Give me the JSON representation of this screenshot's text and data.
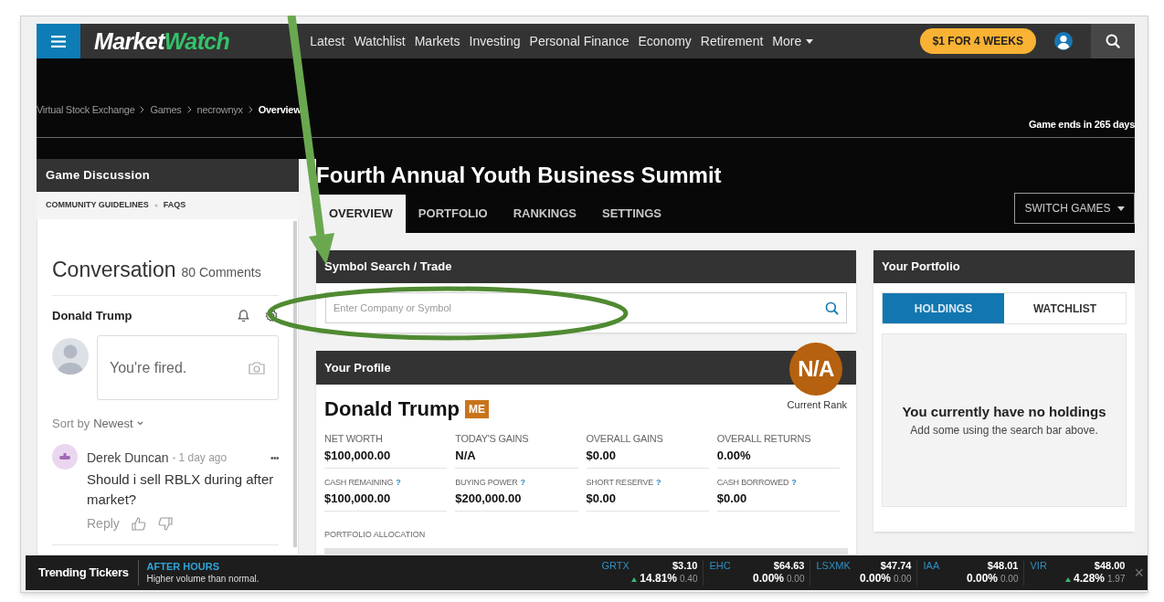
{
  "nav": {
    "logo": {
      "part_1": "Market",
      "part_2": "Watch"
    },
    "links": [
      "Latest",
      "Watchlist",
      "Markets",
      "Investing",
      "Personal Finance",
      "Economy",
      "Retirement",
      "More"
    ],
    "subscribe": "$1 FOR 4 WEEKS"
  },
  "breadcrumb": [
    {
      "label": "Virtual Stock Exchange",
      "current": false
    },
    {
      "label": "Games",
      "current": false
    },
    {
      "label": "necrownyx",
      "current": false
    },
    {
      "label": "Overview",
      "current": true
    }
  ],
  "game_ends": "Game ends in 265 days",
  "game_title": "Fourth Annual Youth Business Summit",
  "tabs": [
    {
      "label": "OVERVIEW",
      "selected": true
    },
    {
      "label": "PORTFOLIO",
      "selected": false
    },
    {
      "label": "RANKINGS",
      "selected": false
    },
    {
      "label": "SETTINGS",
      "selected": false
    }
  ],
  "switch_games": "SWITCH GAMES",
  "discussion": {
    "title": "Game Discussion",
    "links": [
      "COMMUNITY GUIDELINES",
      "FAQS"
    ],
    "heading": "Conversation",
    "count": "80 Comments",
    "user": "Donald Trump",
    "draft": "You're fired.",
    "sort_label": "Sort by",
    "sort_value": "Newest",
    "comments": [
      {
        "author": "Derek Duncan",
        "time": "1 day ago",
        "more": "•••",
        "text": "Should i sell RBLX during after market?",
        "reply": "Reply"
      }
    ]
  },
  "symbol_search": {
    "title": "Symbol Search / Trade",
    "placeholder": "Enter Company or Symbol"
  },
  "profile": {
    "title": "Your Profile",
    "rank": "N/A",
    "rank_label": "Current Rank",
    "name": "Donald Trump",
    "badge": "ME",
    "stats": [
      {
        "label": "NET WORTH",
        "value": "$100,000.00"
      },
      {
        "label": "TODAY'S GAINS",
        "value": "N/A"
      },
      {
        "label": "OVERALL GAINS",
        "value": "$0.00"
      },
      {
        "label": "OVERALL RETURNS",
        "value": "0.00%"
      },
      {
        "label": "CASH REMAINING",
        "help": "?",
        "value": "$100,000.00"
      },
      {
        "label": "BUYING POWER",
        "help": "?",
        "value": "$200,000.00"
      },
      {
        "label": "SHORT RESERVE",
        "help": "?",
        "value": "$0.00"
      },
      {
        "label": "CASH BORROWED",
        "help": "?",
        "value": "$0.00"
      }
    ],
    "allocation_label": "PORTFOLIO ALLOCATION"
  },
  "portfolio": {
    "title": "Your Portfolio",
    "tabs": [
      {
        "label": "HOLDINGS",
        "selected": true
      },
      {
        "label": "WATCHLIST",
        "selected": false
      }
    ],
    "empty_title": "You currently have no holdings",
    "empty_text": "Add some using the search bar above."
  },
  "ticker_bar": {
    "title": "Trending Tickers",
    "session": "AFTER HOURS",
    "note": "Higher volume than normal.",
    "close": "×",
    "tickers": [
      {
        "symbol": "GRTX",
        "price": "$3.10",
        "rising": true,
        "percent": "14.81%",
        "change": "0.40"
      },
      {
        "symbol": "EHC",
        "price": "$64.63",
        "rising": false,
        "percent": "0.00%",
        "change": "0.00"
      },
      {
        "symbol": "LSXMK",
        "price": "$47.74",
        "rising": false,
        "percent": "0.00%",
        "change": "0.00"
      },
      {
        "symbol": "IAA",
        "price": "$48.01",
        "rising": false,
        "percent": "0.00%",
        "change": "0.00"
      },
      {
        "symbol": "VIR",
        "price": "$48.00",
        "rising": true,
        "percent": "4.28%",
        "change": "1.97"
      }
    ]
  }
}
